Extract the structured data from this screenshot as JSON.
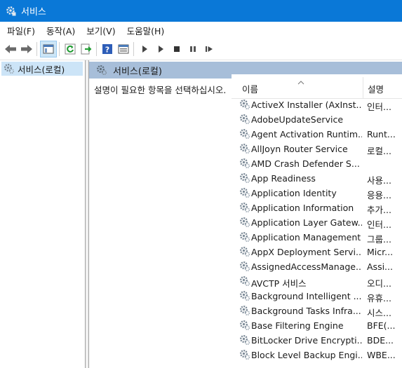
{
  "window": {
    "title": "서비스"
  },
  "menu": [
    "파일(F)",
    "동작(A)",
    "보기(V)",
    "도움말(H)"
  ],
  "toolbar": {
    "buttons": [
      "back-arrow-icon",
      "forward-arrow-icon",
      "show-tree-icon",
      "refresh-icon",
      "export-list-icon",
      "help-icon",
      "properties-icon",
      "play-icon",
      "play-alt-icon",
      "stop-icon",
      "pause-icon",
      "restart-icon"
    ]
  },
  "tree": {
    "selected": "서비스(로컬)"
  },
  "content": {
    "header": "서비스(로컬)",
    "description": "설명이 필요한 항목을 선택하십시오."
  },
  "list": {
    "columns": {
      "name": "이름",
      "description": "설명"
    },
    "sort_indicator": "^",
    "rows": [
      {
        "name": "ActiveX Installer (AxInst...",
        "desc": "인터..."
      },
      {
        "name": "AdobeUpdateService",
        "desc": ""
      },
      {
        "name": "Agent Activation Runtim...",
        "desc": "Runt..."
      },
      {
        "name": "AllJoyn Router Service",
        "desc": "로컬..."
      },
      {
        "name": "AMD Crash Defender S...",
        "desc": ""
      },
      {
        "name": "App Readiness",
        "desc": "사용..."
      },
      {
        "name": "Application Identity",
        "desc": "응용..."
      },
      {
        "name": "Application Information",
        "desc": "추가..."
      },
      {
        "name": "Application Layer Gatew...",
        "desc": "인터..."
      },
      {
        "name": "Application Management",
        "desc": "그룹..."
      },
      {
        "name": "AppX Deployment Servi...",
        "desc": "Micr..."
      },
      {
        "name": "AssignedAccessManage...",
        "desc": "Assi..."
      },
      {
        "name": "AVCTP 서비스",
        "desc": "오디..."
      },
      {
        "name": "Background Intelligent ...",
        "desc": "유휴..."
      },
      {
        "name": "Background Tasks Infra...",
        "desc": "시스..."
      },
      {
        "name": "Base Filtering Engine",
        "desc": "BFE(..."
      },
      {
        "name": "BitLocker Drive Encrypti...",
        "desc": "BDE..."
      },
      {
        "name": "Block Level Backup Engi...",
        "desc": "WBE..."
      }
    ]
  }
}
